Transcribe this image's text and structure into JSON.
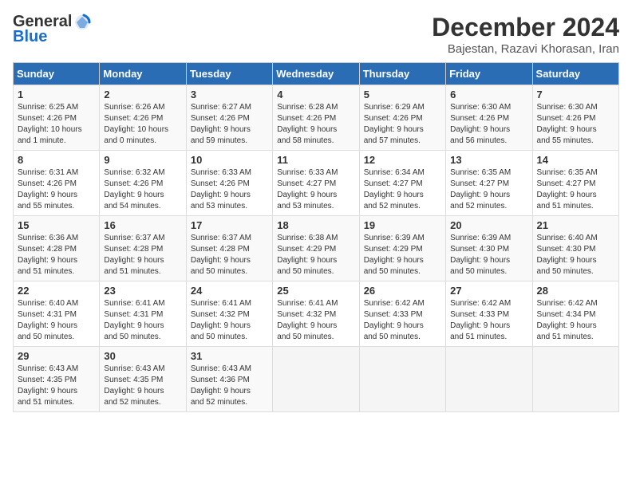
{
  "header": {
    "logo_general": "General",
    "logo_blue": "Blue",
    "month_title": "December 2024",
    "location": "Bajestan, Razavi Khorasan, Iran"
  },
  "days_of_week": [
    "Sunday",
    "Monday",
    "Tuesday",
    "Wednesday",
    "Thursday",
    "Friday",
    "Saturday"
  ],
  "weeks": [
    [
      {
        "day": "1",
        "info": "Sunrise: 6:25 AM\nSunset: 4:26 PM\nDaylight: 10 hours\nand 1 minute."
      },
      {
        "day": "2",
        "info": "Sunrise: 6:26 AM\nSunset: 4:26 PM\nDaylight: 10 hours\nand 0 minutes."
      },
      {
        "day": "3",
        "info": "Sunrise: 6:27 AM\nSunset: 4:26 PM\nDaylight: 9 hours\nand 59 minutes."
      },
      {
        "day": "4",
        "info": "Sunrise: 6:28 AM\nSunset: 4:26 PM\nDaylight: 9 hours\nand 58 minutes."
      },
      {
        "day": "5",
        "info": "Sunrise: 6:29 AM\nSunset: 4:26 PM\nDaylight: 9 hours\nand 57 minutes."
      },
      {
        "day": "6",
        "info": "Sunrise: 6:30 AM\nSunset: 4:26 PM\nDaylight: 9 hours\nand 56 minutes."
      },
      {
        "day": "7",
        "info": "Sunrise: 6:30 AM\nSunset: 4:26 PM\nDaylight: 9 hours\nand 55 minutes."
      }
    ],
    [
      {
        "day": "8",
        "info": "Sunrise: 6:31 AM\nSunset: 4:26 PM\nDaylight: 9 hours\nand 55 minutes."
      },
      {
        "day": "9",
        "info": "Sunrise: 6:32 AM\nSunset: 4:26 PM\nDaylight: 9 hours\nand 54 minutes."
      },
      {
        "day": "10",
        "info": "Sunrise: 6:33 AM\nSunset: 4:26 PM\nDaylight: 9 hours\nand 53 minutes."
      },
      {
        "day": "11",
        "info": "Sunrise: 6:33 AM\nSunset: 4:27 PM\nDaylight: 9 hours\nand 53 minutes."
      },
      {
        "day": "12",
        "info": "Sunrise: 6:34 AM\nSunset: 4:27 PM\nDaylight: 9 hours\nand 52 minutes."
      },
      {
        "day": "13",
        "info": "Sunrise: 6:35 AM\nSunset: 4:27 PM\nDaylight: 9 hours\nand 52 minutes."
      },
      {
        "day": "14",
        "info": "Sunrise: 6:35 AM\nSunset: 4:27 PM\nDaylight: 9 hours\nand 51 minutes."
      }
    ],
    [
      {
        "day": "15",
        "info": "Sunrise: 6:36 AM\nSunset: 4:28 PM\nDaylight: 9 hours\nand 51 minutes."
      },
      {
        "day": "16",
        "info": "Sunrise: 6:37 AM\nSunset: 4:28 PM\nDaylight: 9 hours\nand 51 minutes."
      },
      {
        "day": "17",
        "info": "Sunrise: 6:37 AM\nSunset: 4:28 PM\nDaylight: 9 hours\nand 50 minutes."
      },
      {
        "day": "18",
        "info": "Sunrise: 6:38 AM\nSunset: 4:29 PM\nDaylight: 9 hours\nand 50 minutes."
      },
      {
        "day": "19",
        "info": "Sunrise: 6:39 AM\nSunset: 4:29 PM\nDaylight: 9 hours\nand 50 minutes."
      },
      {
        "day": "20",
        "info": "Sunrise: 6:39 AM\nSunset: 4:30 PM\nDaylight: 9 hours\nand 50 minutes."
      },
      {
        "day": "21",
        "info": "Sunrise: 6:40 AM\nSunset: 4:30 PM\nDaylight: 9 hours\nand 50 minutes."
      }
    ],
    [
      {
        "day": "22",
        "info": "Sunrise: 6:40 AM\nSunset: 4:31 PM\nDaylight: 9 hours\nand 50 minutes."
      },
      {
        "day": "23",
        "info": "Sunrise: 6:41 AM\nSunset: 4:31 PM\nDaylight: 9 hours\nand 50 minutes."
      },
      {
        "day": "24",
        "info": "Sunrise: 6:41 AM\nSunset: 4:32 PM\nDaylight: 9 hours\nand 50 minutes."
      },
      {
        "day": "25",
        "info": "Sunrise: 6:41 AM\nSunset: 4:32 PM\nDaylight: 9 hours\nand 50 minutes."
      },
      {
        "day": "26",
        "info": "Sunrise: 6:42 AM\nSunset: 4:33 PM\nDaylight: 9 hours\nand 50 minutes."
      },
      {
        "day": "27",
        "info": "Sunrise: 6:42 AM\nSunset: 4:33 PM\nDaylight: 9 hours\nand 51 minutes."
      },
      {
        "day": "28",
        "info": "Sunrise: 6:42 AM\nSunset: 4:34 PM\nDaylight: 9 hours\nand 51 minutes."
      }
    ],
    [
      {
        "day": "29",
        "info": "Sunrise: 6:43 AM\nSunset: 4:35 PM\nDaylight: 9 hours\nand 51 minutes."
      },
      {
        "day": "30",
        "info": "Sunrise: 6:43 AM\nSunset: 4:35 PM\nDaylight: 9 hours\nand 52 minutes."
      },
      {
        "day": "31",
        "info": "Sunrise: 6:43 AM\nSunset: 4:36 PM\nDaylight: 9 hours\nand 52 minutes."
      },
      {
        "day": "",
        "info": ""
      },
      {
        "day": "",
        "info": ""
      },
      {
        "day": "",
        "info": ""
      },
      {
        "day": "",
        "info": ""
      }
    ]
  ]
}
